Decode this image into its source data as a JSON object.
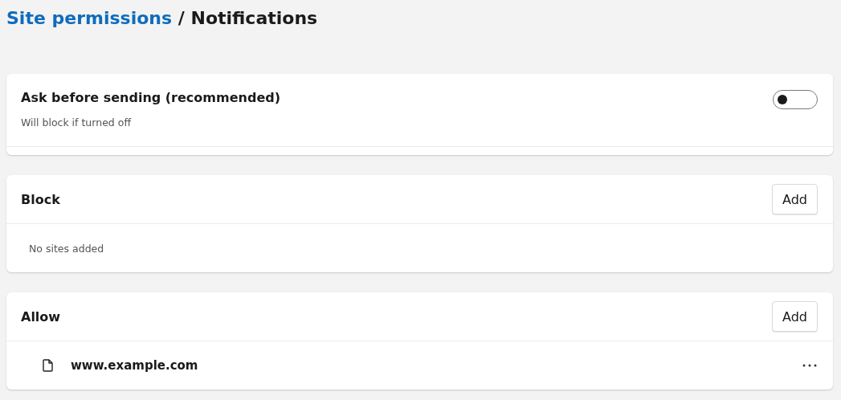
{
  "breadcrumb": {
    "link": "Site permissions",
    "separator": "/",
    "current": "Notifications"
  },
  "ask_setting": {
    "title": "Ask before sending (recommended)",
    "description": "Will block if turned off",
    "on": false
  },
  "lists": [
    {
      "title": "Block",
      "add_button": "Add",
      "empty_text": "No sites added"
    },
    {
      "title": "Allow",
      "add_button": "Add",
      "sites": [
        {
          "site": "www.example.com"
        }
      ]
    }
  ]
}
